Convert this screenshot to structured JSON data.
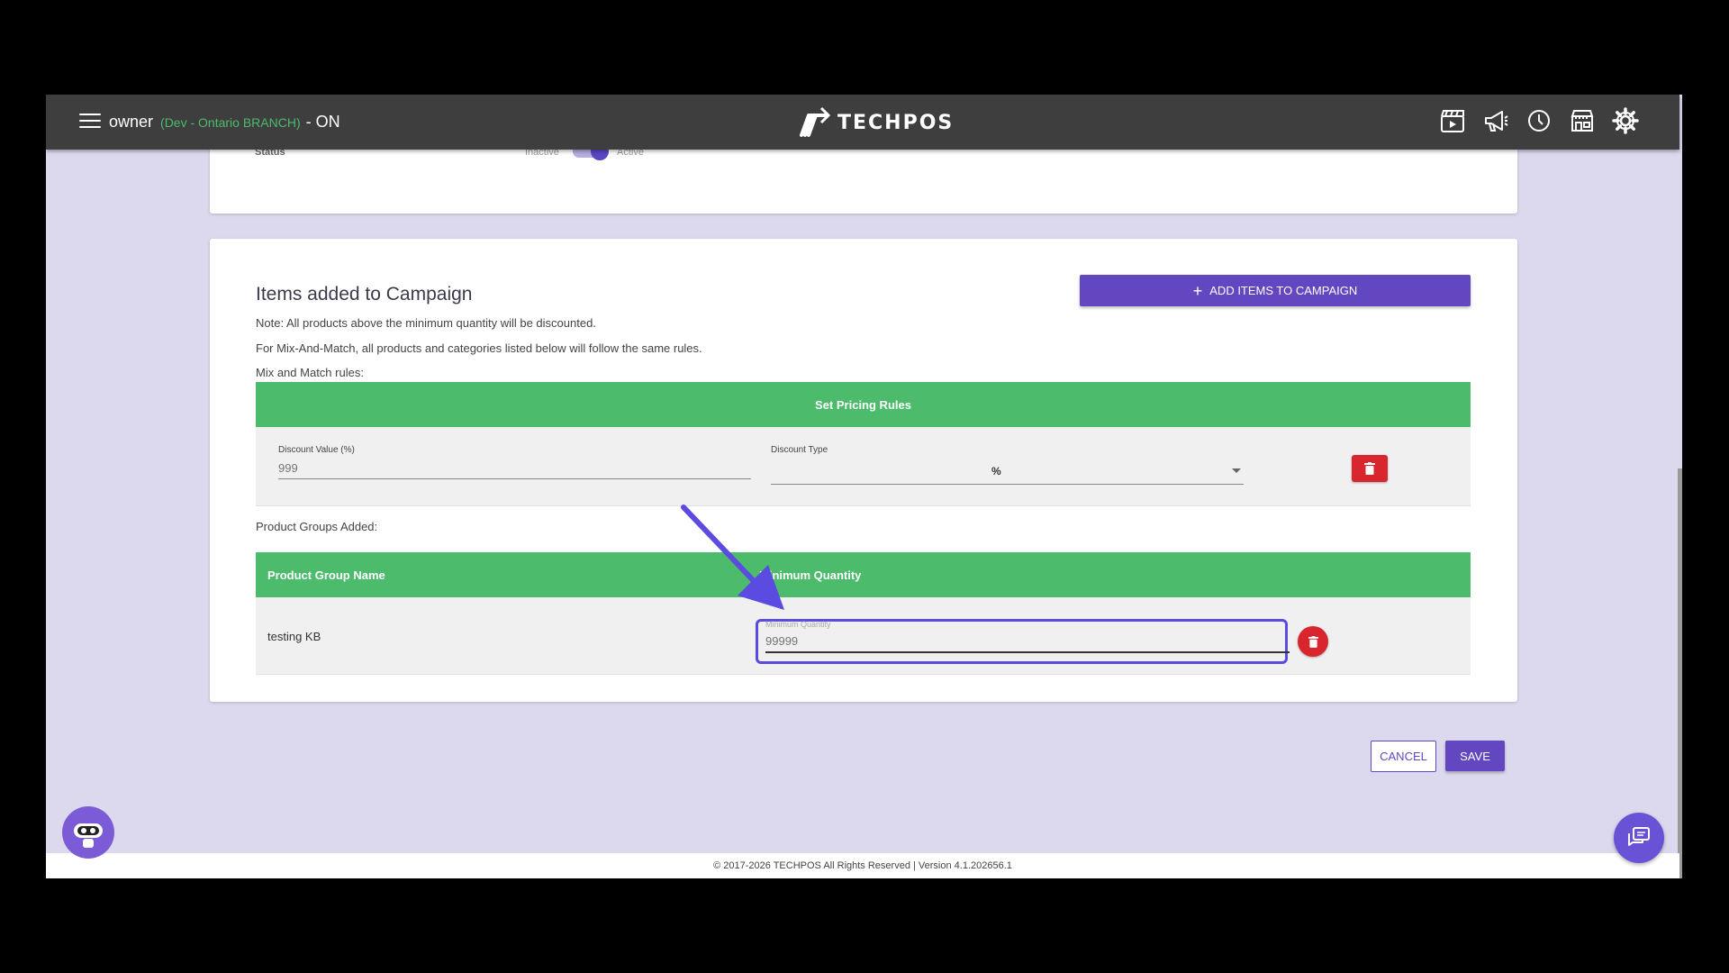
{
  "header": {
    "user": "owner",
    "branch": "(Dev - Ontario BRANCH)",
    "status": "- ON",
    "logo_text": "TECHPOS",
    "icons": [
      "clapperboard-icon",
      "megaphone-icon",
      "clock-icon",
      "store-icon",
      "gear-icon"
    ]
  },
  "status_card": {
    "label": "Status",
    "inactive": "Inactive",
    "active": "Active"
  },
  "campaign": {
    "title": "Items added to Campaign",
    "add_button": "ADD ITEMS TO CAMPAIGN",
    "note1": "Note: All products above the minimum quantity will be discounted.",
    "note2": "For Mix-And-Match, all products and categories listed below will follow the same rules.",
    "mix_label": "Mix and Match rules:",
    "pricing_header": "Set Pricing Rules",
    "discount_value_label": "Discount Value (%)",
    "discount_value_placeholder": "999",
    "discount_type_label": "Discount Type",
    "discount_type_value": "%",
    "groups_label": "Product Groups Added:",
    "col_name": "Product Group Name",
    "col_min_qty": "Minimum Quantity",
    "group_row": {
      "name": "testing KB",
      "qty_label": "Minimum Quantity",
      "qty_placeholder": "99999"
    }
  },
  "actions": {
    "cancel": "CANCEL",
    "save": "SAVE"
  },
  "footer": {
    "text": "© 2017-2026 TECHPOS All Rights Reserved | Version 4.1.202656.1"
  },
  "colors": {
    "accent": "#6247c0",
    "green": "#4cbb6c",
    "danger": "#d9262e",
    "highlight": "#5b4be0"
  }
}
